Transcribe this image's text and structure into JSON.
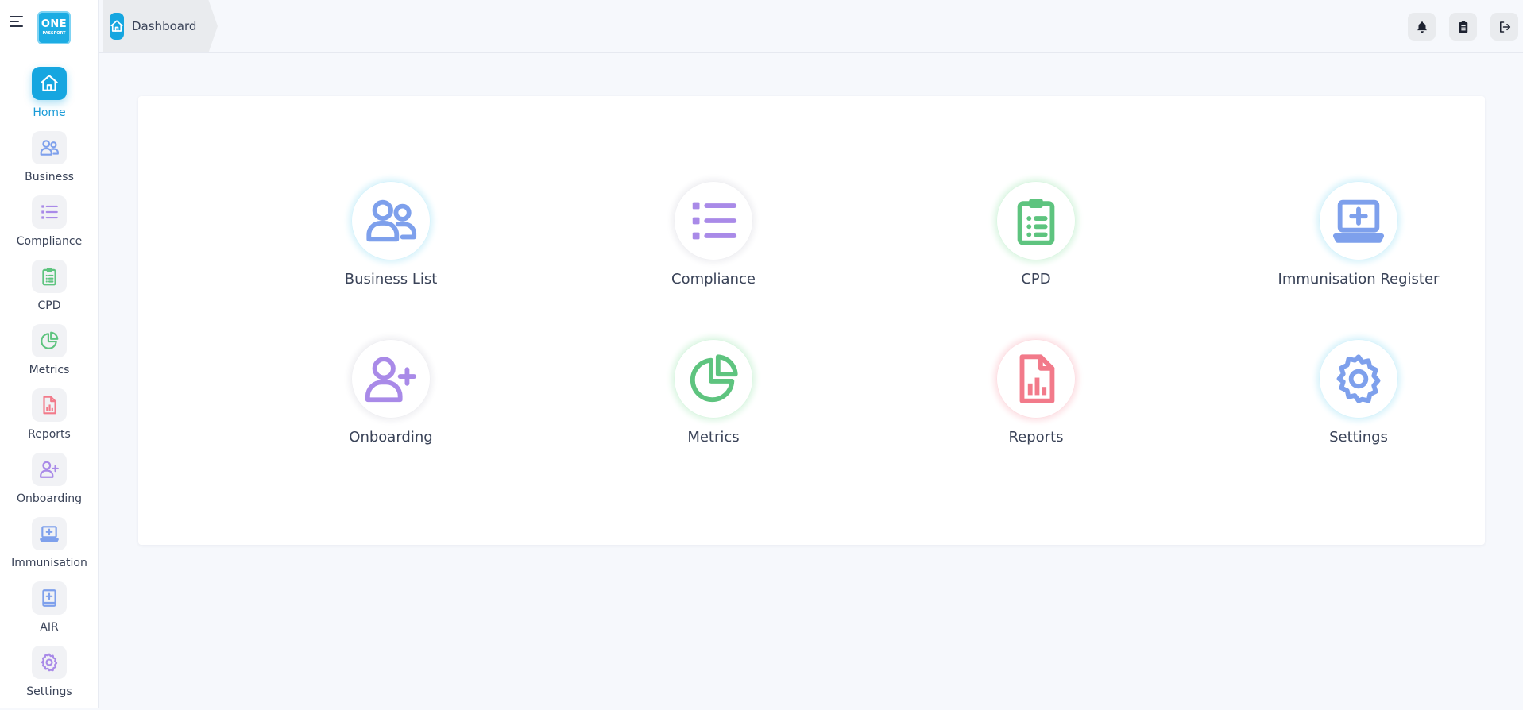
{
  "brand": {
    "logo_text": "ONE",
    "logo_sub": "PASSPORT"
  },
  "sidebar": {
    "items": [
      {
        "label": "Home",
        "icon": "home-icon",
        "color": "#ffffff",
        "active": true
      },
      {
        "label": "Business",
        "icon": "users-icon",
        "color": "#7ea0ec"
      },
      {
        "label": "Compliance",
        "icon": "list-icon",
        "color": "#a98ae8"
      },
      {
        "label": "CPD",
        "icon": "clipboard-icon",
        "color": "#5ec47f"
      },
      {
        "label": "Metrics",
        "icon": "pie-chart-icon",
        "color": "#5ec47f"
      },
      {
        "label": "Reports",
        "icon": "report-file-icon",
        "color": "#f27a8a"
      },
      {
        "label": "Onboarding",
        "icon": "user-plus-icon",
        "color": "#a98ae8"
      },
      {
        "label": "Immunisation",
        "icon": "laptop-medical-icon",
        "color": "#7ea0ec"
      },
      {
        "label": "AIR",
        "icon": "medical-book-icon",
        "color": "#7ea0ec"
      },
      {
        "label": "Settings",
        "icon": "gear-icon",
        "color": "#a98ae8"
      }
    ]
  },
  "header": {
    "breadcrumb": "Dashboard",
    "actions": [
      {
        "name": "notifications-button",
        "icon": "bell-icon"
      },
      {
        "name": "clipboard-button",
        "icon": "clipboard-icon"
      },
      {
        "name": "logout-button",
        "icon": "logout-icon"
      }
    ]
  },
  "tiles": [
    {
      "label": "Business List",
      "icon": "users-icon",
      "color": "#7ea0ec",
      "glow": "#d8f3fb"
    },
    {
      "label": "Compliance",
      "icon": "list-icon",
      "color": "#a98ae8",
      "glow": "#f0f0f3"
    },
    {
      "label": "CPD",
      "icon": "clipboard-icon",
      "color": "#5ec47f",
      "glow": "#dcf6e3"
    },
    {
      "label": "Immunisation Register",
      "icon": "laptop-medical-icon",
      "color": "#7ea0ec",
      "glow": "#d8f3fb"
    },
    {
      "label": "Onboarding",
      "icon": "user-plus-icon",
      "color": "#a98ae8",
      "glow": "#f0f0f3"
    },
    {
      "label": "Metrics",
      "icon": "pie-chart-icon",
      "color": "#5ec47f",
      "glow": "#dcf6e3"
    },
    {
      "label": "Reports",
      "icon": "report-file-icon",
      "color": "#f27a8a",
      "glow": "#fde0e4"
    },
    {
      "label": "Settings",
      "icon": "gear-icon",
      "color": "#7ea0ec",
      "glow": "#d8f3fb"
    }
  ],
  "colors": {
    "accent": "#16a6e0",
    "active_label": "#1a9bd7"
  }
}
